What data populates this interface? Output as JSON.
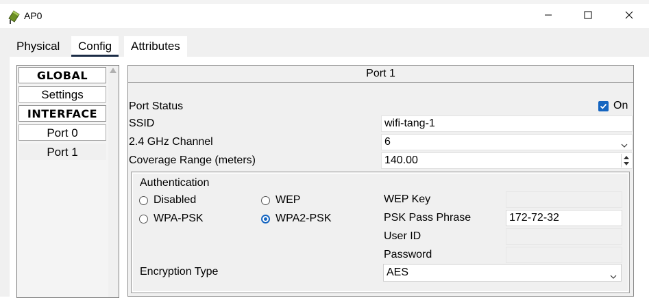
{
  "window": {
    "title": "AP0",
    "icon": "access-point-icon",
    "controls": [
      "minimize-icon",
      "maximize-icon",
      "close-icon"
    ]
  },
  "tabs": [
    {
      "label": "Physical"
    },
    {
      "label": "Config"
    },
    {
      "label": "Attributes"
    }
  ],
  "active_tab": "Config",
  "sidebar": {
    "global_header": "GLOBAL",
    "settings": "Settings",
    "interface_header": "INTERFACE",
    "items": [
      {
        "label": "Port 0"
      },
      {
        "label": "Port 1"
      }
    ],
    "active_item": "Port 1"
  },
  "port": {
    "header": "Port 1",
    "status_label": "Port Status",
    "status_checkbox_label": "On",
    "status_checked": true,
    "ssid_label": "SSID",
    "ssid_value": "wifi-tang-1",
    "channel_label": "2.4 GHz Channel",
    "channel_value": "6",
    "coverage_label": "Coverage Range (meters)",
    "coverage_value": "140.00"
  },
  "authentication": {
    "title": "Authentication",
    "options": [
      {
        "label": "Disabled",
        "selected": false
      },
      {
        "label": "WEP",
        "selected": false
      },
      {
        "label": "WPA-PSK",
        "selected": false
      },
      {
        "label": "WPA2-PSK",
        "selected": true
      }
    ],
    "wep_key_label": "WEP Key",
    "wep_key_value": "",
    "psk_label": "PSK Pass Phrase",
    "psk_value": "172-72-32",
    "user_id_label": "User ID",
    "user_id_value": "",
    "password_label": "Password",
    "password_value": "",
    "encryption_label": "Encryption Type",
    "encryption_value": "AES"
  },
  "colors": {
    "accent": "#1565c0",
    "tab_underline": "#1a2b45",
    "client_bg": "#f0f0f0"
  }
}
